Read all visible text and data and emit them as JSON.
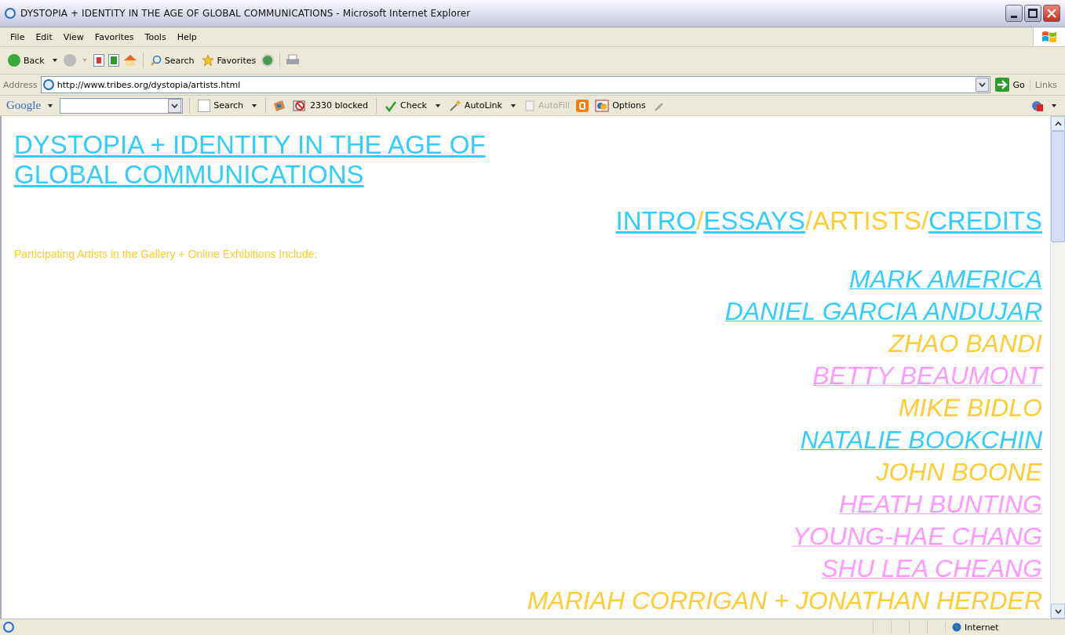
{
  "window": {
    "title": "DYSTOPIA + IDENTITY IN THE AGE OF GLOBAL COMMUNICATIONS - Microsoft Internet Explorer"
  },
  "menu": [
    "File",
    "Edit",
    "View",
    "Favorites",
    "Tools",
    "Help"
  ],
  "toolbar": {
    "back": "Back",
    "search": "Search",
    "favorites": "Favorites"
  },
  "address": {
    "label": "Address",
    "url": "http://www.tribes.org/dystopia/artists.html",
    "go": "Go",
    "links": "Links"
  },
  "google_bar": {
    "logo": "Google",
    "search": "Search",
    "blocked": "2330 blocked",
    "check": "Check",
    "autolink": "AutoLink",
    "autofill": "AutoFill",
    "options": "Options"
  },
  "page": {
    "title": "DYSTOPIA + IDENTITY IN THE AGE OF GLOBAL COMMUNICATIONS",
    "nav": [
      {
        "label": "INTRO",
        "kind": "link"
      },
      {
        "label": "/",
        "kind": "separator"
      },
      {
        "label": "ESSAYS",
        "kind": "link"
      },
      {
        "label": "/",
        "kind": "separator"
      },
      {
        "label": "ARTISTS",
        "kind": "current"
      },
      {
        "label": "/",
        "kind": "separator"
      },
      {
        "label": "CREDITS",
        "kind": "link"
      }
    ],
    "intro": "Participating Artists in the Gallery + Online Exhibitions Include:",
    "artists": [
      {
        "name": "MARK AMERICA",
        "link": true,
        "color": "#33ccff"
      },
      {
        "name": "DANIEL GARCIA ANDUJAR",
        "link": true,
        "color": "#33ccff"
      },
      {
        "name": "ZHAO BANDI",
        "link": false,
        "color": "#ffcc33"
      },
      {
        "name": "BETTY BEAUMONT",
        "link": true,
        "color": "#ff99ff"
      },
      {
        "name": "MIKE BIDLO",
        "link": false,
        "color": "#ffcc33"
      },
      {
        "name": "NATALIE BOOKCHIN",
        "link": true,
        "color": "#33ccff"
      },
      {
        "name": "JOHN BOONE",
        "link": false,
        "color": "#ffcc33"
      },
      {
        "name": "HEATH BUNTING",
        "link": true,
        "color": "#ff99ff"
      },
      {
        "name": "YOUNG-HAE CHANG",
        "link": true,
        "color": "#ff99ff"
      },
      {
        "name": "SHU LEA CHEANG",
        "link": true,
        "color": "#ff99ff"
      },
      {
        "name": "MARIAH CORRIGAN + JONATHAN HERDER",
        "link": false,
        "color": "#ffcc33"
      }
    ]
  },
  "status_bar": {
    "zone": "Internet"
  }
}
